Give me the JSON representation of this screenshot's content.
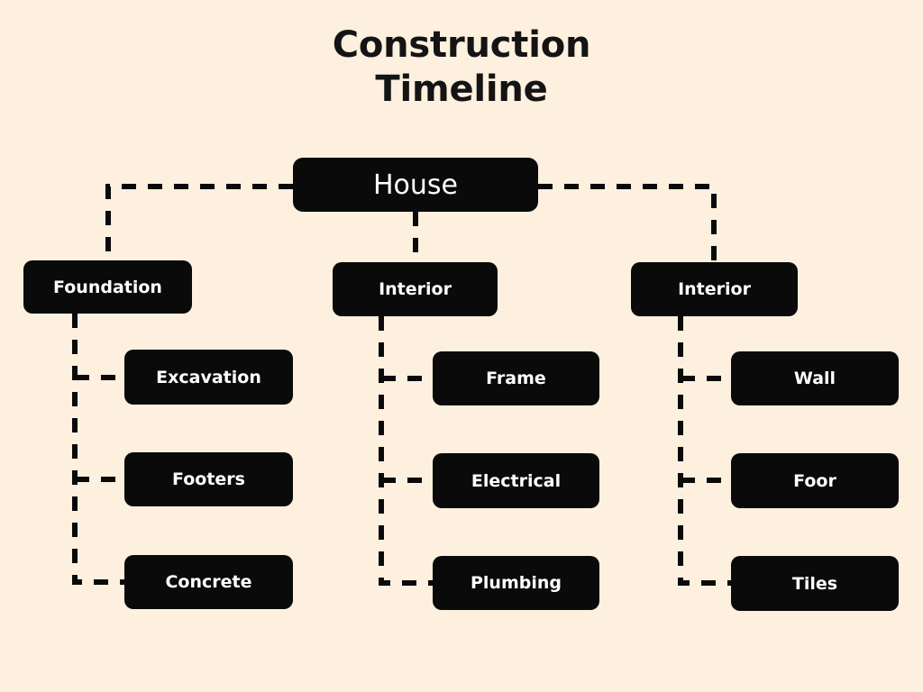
{
  "diagram": {
    "title": "Construction\nTimeline",
    "background_color": "#fdf0de",
    "node_color": "#0a0a0a",
    "node_text_color": "#ffffff",
    "connector_color": "#0a0a0a",
    "connector_style": "dashed"
  },
  "chart_data": {
    "type": "tree-diagram",
    "title": "Construction Timeline",
    "root": "House",
    "nodes": [
      {
        "id": "house",
        "label": "House",
        "level": 0,
        "parent": null
      },
      {
        "id": "foundation",
        "label": "Foundation",
        "level": 1,
        "parent": "house"
      },
      {
        "id": "interior1",
        "label": "Interior",
        "level": 1,
        "parent": "house"
      },
      {
        "id": "interior2",
        "label": "Interior",
        "level": 1,
        "parent": "house"
      },
      {
        "id": "excavation",
        "label": "Excavation",
        "level": 2,
        "parent": "foundation"
      },
      {
        "id": "footers",
        "label": "Footers",
        "level": 2,
        "parent": "foundation"
      },
      {
        "id": "concrete",
        "label": "Concrete",
        "level": 2,
        "parent": "foundation"
      },
      {
        "id": "frame",
        "label": "Frame",
        "level": 2,
        "parent": "interior1"
      },
      {
        "id": "electrical",
        "label": "Electrical",
        "level": 2,
        "parent": "interior1"
      },
      {
        "id": "plumbing",
        "label": "Plumbing",
        "level": 2,
        "parent": "interior1"
      },
      {
        "id": "wall",
        "label": "Wall",
        "level": 2,
        "parent": "interior2"
      },
      {
        "id": "foor",
        "label": "Foor",
        "level": 2,
        "parent": "interior2"
      },
      {
        "id": "tiles",
        "label": "Tiles",
        "level": 2,
        "parent": "interior2"
      }
    ]
  },
  "nodes": {
    "root": {
      "label": "House"
    },
    "branches": [
      {
        "label": "Foundation"
      },
      {
        "label": "Interior"
      },
      {
        "label": "Interior"
      }
    ],
    "leaves": {
      "foundation": [
        {
          "label": "Excavation"
        },
        {
          "label": "Footers"
        },
        {
          "label": "Concrete"
        }
      ],
      "interior_left": [
        {
          "label": "Frame"
        },
        {
          "label": "Electrical"
        },
        {
          "label": "Plumbing"
        }
      ],
      "interior_right": [
        {
          "label": "Wall"
        },
        {
          "label": "Foor"
        },
        {
          "label": "Tiles"
        }
      ]
    }
  }
}
